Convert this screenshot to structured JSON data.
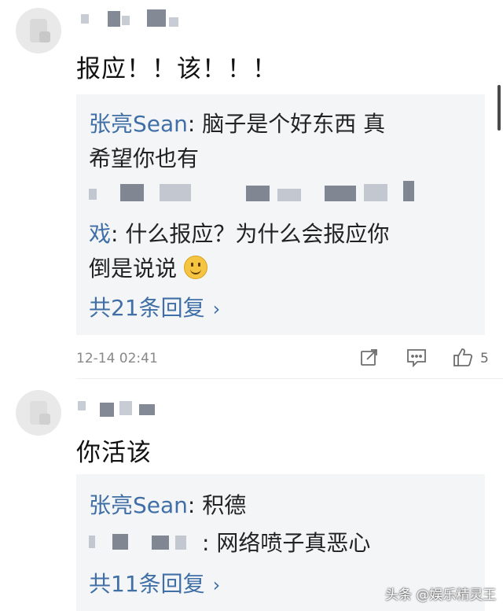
{
  "comments": [
    {
      "text": "报应！！该！！！",
      "replies": [
        {
          "user": "张亮Sean",
          "text": ": 脑子是个好东西 真",
          "text2": "希望你也有"
        },
        {
          "user": "戏",
          "text": ": 什么报应？为什么会报应你",
          "text2": "倒是说说"
        }
      ],
      "more_label": "共21条回复",
      "timestamp": "12-14 02:41",
      "like_count": "5"
    },
    {
      "text": "你活该",
      "replies": [
        {
          "user": "张亮Sean",
          "text": ": 积德"
        },
        {
          "user": "",
          "text": "网络喷子真恶心"
        }
      ],
      "more_label": "共11条回复"
    }
  ],
  "watermark": "头条 @娱乐精灵王",
  "icons": {
    "share": "share-icon",
    "comment": "comment-icon",
    "like": "thumbs-up-icon",
    "chevron": "chevron-right-icon",
    "emoji": "smile-emoji-icon"
  },
  "colors": {
    "reply_user": "#3f6fa6",
    "reply_bg": "#f4f5f7",
    "meta": "#888888"
  }
}
